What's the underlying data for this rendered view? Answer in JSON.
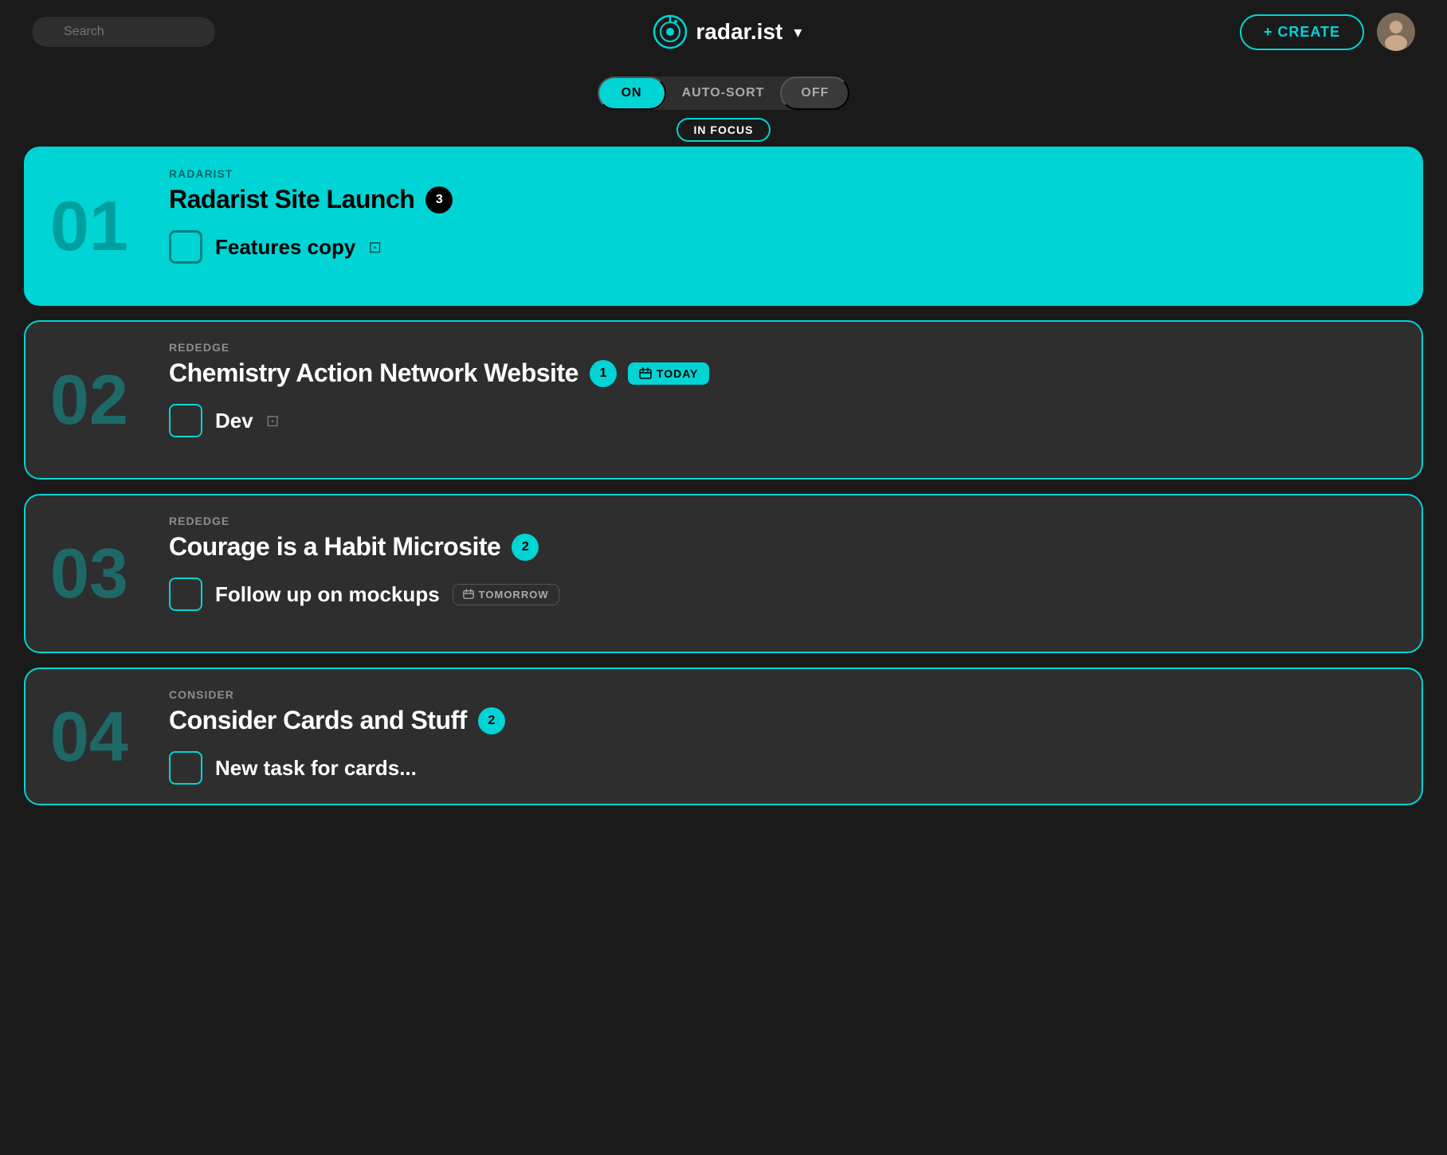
{
  "header": {
    "search_placeholder": "Search",
    "logo_text": "radar.ist",
    "create_label": "+ CREATE",
    "avatar_emoji": "👤"
  },
  "autosort": {
    "on_label": "ON",
    "middle_label": "AUTO-SORT",
    "off_label": "OFF"
  },
  "section": {
    "label": "IN FOCUS"
  },
  "tasks": [
    {
      "number": "01",
      "project": "RADARIST",
      "title": "Radarist Site Launch",
      "count": "3",
      "due": null,
      "item_name": "Features copy",
      "has_note": true,
      "card_type": "light"
    },
    {
      "number": "02",
      "project": "REDEDGE",
      "title": "Chemistry Action Network Website",
      "count": "1",
      "due": "TODAY",
      "item_name": "Dev",
      "has_note": true,
      "card_type": "dark"
    },
    {
      "number": "03",
      "project": "REDEDGE",
      "title": "Courage is a Habit Microsite",
      "count": "2",
      "due": null,
      "item_name": "Follow up on mockups",
      "has_note": false,
      "due_item": "TOMORROW",
      "card_type": "dark"
    },
    {
      "number": "04",
      "project": "CONSIDER",
      "title": "Consider Cards and Stuff",
      "count": "2",
      "due": null,
      "item_name": "New task for cards...",
      "has_note": false,
      "card_type": "dark",
      "partial": true
    }
  ]
}
